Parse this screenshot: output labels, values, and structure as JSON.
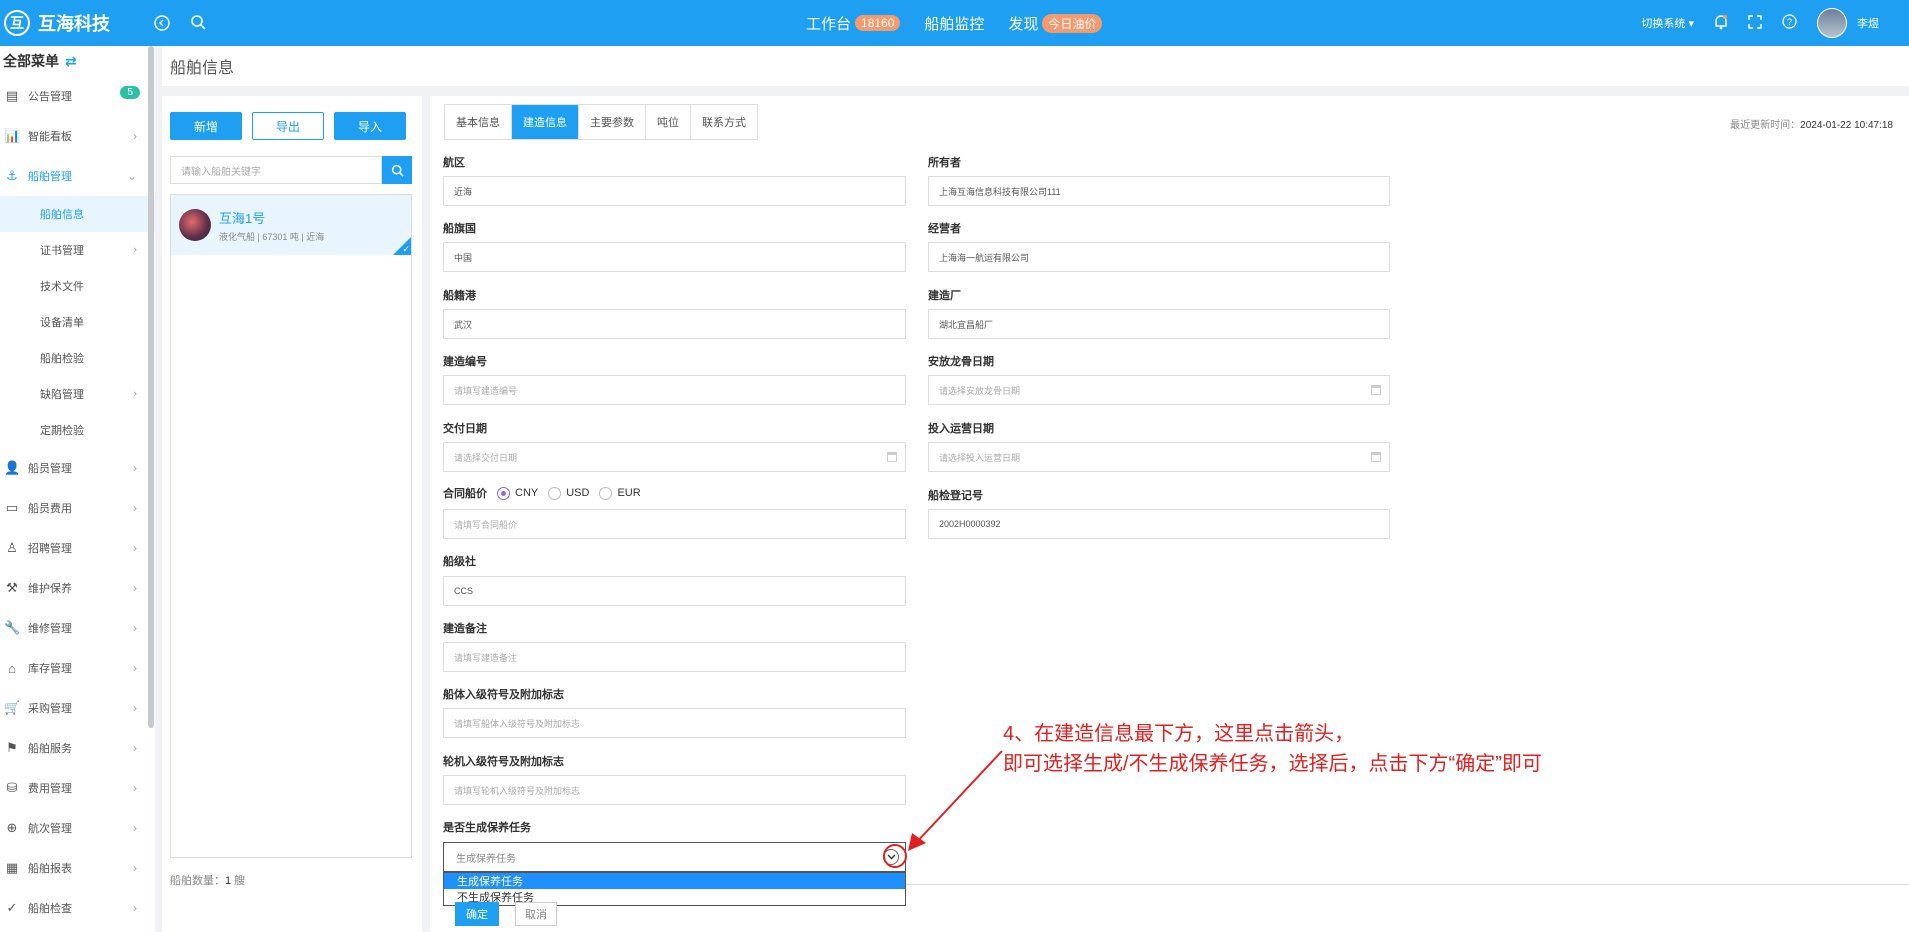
{
  "app": {
    "logo_char": "互",
    "name": "互海科技"
  },
  "topnav": [
    {
      "label": "工作台",
      "badge": "18160"
    },
    {
      "label": "船舶监控",
      "badge": ""
    },
    {
      "label": "发现",
      "badge": "今日油价"
    }
  ],
  "topright": {
    "switch_label": "切换系统 ▾",
    "user": "李煜"
  },
  "sidebar": {
    "title": "全部菜单",
    "items": [
      {
        "label": "公告管理",
        "icon": "document-icon",
        "badge": "5"
      },
      {
        "label": "智能看板",
        "icon": "chart-icon"
      },
      {
        "label": "船舶管理",
        "icon": "anchor-icon"
      },
      {
        "label": "船员管理",
        "icon": "person-icon"
      },
      {
        "label": "船员费用",
        "icon": "wallet-icon"
      },
      {
        "label": "招聘管理",
        "icon": "recruit-icon"
      },
      {
        "label": "维护保养",
        "icon": "tool-icon"
      },
      {
        "label": "维修管理",
        "icon": "wrench-icon"
      },
      {
        "label": "库存管理",
        "icon": "warehouse-icon"
      },
      {
        "label": "采购管理",
        "icon": "cart-icon"
      },
      {
        "label": "船舶服务",
        "icon": "paint-icon"
      },
      {
        "label": "费用管理",
        "icon": "coins-icon"
      },
      {
        "label": "航次管理",
        "icon": "globe-icon"
      },
      {
        "label": "船舶报表",
        "icon": "table-icon"
      },
      {
        "label": "船舶检查",
        "icon": "check-circle-icon"
      }
    ],
    "subitems": [
      {
        "label": "船舶信息"
      },
      {
        "label": "证书管理"
      },
      {
        "label": "技术文件"
      },
      {
        "label": "设备清单"
      },
      {
        "label": "船舶检验"
      },
      {
        "label": "缺陷管理"
      },
      {
        "label": "定期检验"
      }
    ]
  },
  "page": {
    "title": "船舶信息"
  },
  "left": {
    "buttons": {
      "add": "新增",
      "export": "导出",
      "import": "导入"
    },
    "search_placeholder": "请输入船舶关键字",
    "ship": {
      "name": "互海1号",
      "desc": "液化气船 | 67301 吨 | 近海"
    },
    "count_label": "船舶数量：",
    "count_value": "1",
    "count_unit": " 艘"
  },
  "tabs": [
    "基本信息",
    "建造信息",
    "主要参数",
    "吨位",
    "联系方式"
  ],
  "active_tab": "建造信息",
  "updated": {
    "label": "最近更新时间：",
    "value": "2024-01-22 10:47:18"
  },
  "form": {
    "area_label": "航区",
    "area_value": "近海",
    "owner_label": "所有者",
    "owner_value": "上海互海信息科技有限公司111",
    "flag_label": "船旗国",
    "flag_value": "中国",
    "operator_label": "经营者",
    "operator_value": "上海海一航运有限公司",
    "port_label": "船籍港",
    "port_value": "武汉",
    "builder_label": "建造厂",
    "builder_value": "湖北宜昌船厂",
    "buildno_label": "建造编号",
    "buildno_placeholder": "请填写建造编号",
    "keel_label": "安放龙骨日期",
    "keel_placeholder": "请选择安放龙骨日期",
    "delivery_label": "交付日期",
    "delivery_placeholder": "请选择交付日期",
    "service_label": "投入运营日期",
    "service_placeholder": "请选择投入运营日期",
    "price_label": "合同船价",
    "currencies": [
      "CNY",
      "USD",
      "EUR"
    ],
    "price_placeholder": "请填写合同船价",
    "regno_label": "船检登记号",
    "regno_value": "2002H0000392",
    "class_label": "船级社",
    "class_value": "CCS",
    "note_label": "建造备注",
    "note_placeholder": "请填写建造备注",
    "hullclass_label": "船体入级符号及附加标志",
    "hullclass_placeholder": "请填写船体入级符号及附加标志",
    "engclass_label": "轮机入级符号及附加标志",
    "engclass_placeholder": "请填写轮机入级符号及附加标志",
    "maint_label": "是否生成保养任务",
    "maint_value": "生成保养任务",
    "maint_options": [
      "生成保养任务",
      "不生成保养任务"
    ]
  },
  "actions": {
    "ok": "确定",
    "cancel": "取消"
  },
  "annotation": {
    "line1": "4、在建造信息最下方，这里点击箭头，",
    "line2": "即可选择生成/不生成保养任务，选择后，点击下方“确定”即可",
    "color": "#e02020"
  },
  "colors": {
    "primary": "#1e9ff2",
    "badge": "#f59a6e",
    "badge_green": "#2bc0a6"
  }
}
